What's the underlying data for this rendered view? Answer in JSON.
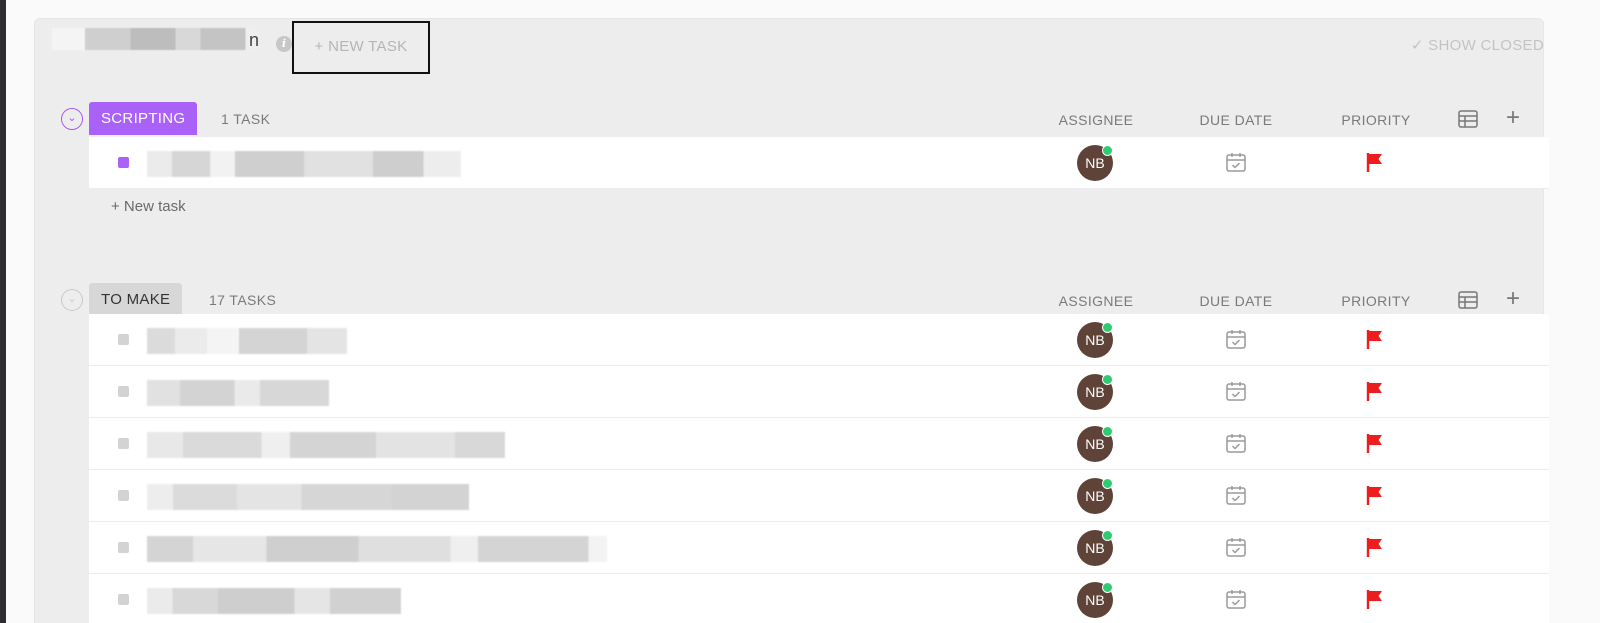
{
  "header": {
    "list_title_suffix": "n",
    "new_task_label": "+ NEW TASK",
    "show_closed_label": "✓ SHOW CLOSED"
  },
  "columns": {
    "assignee": "ASSIGNEE",
    "due_date": "DUE DATE",
    "priority": "PRIORITY"
  },
  "groups": [
    {
      "status": "SCRIPTING",
      "count": "1 TASK",
      "color": "#a961f7",
      "new_task_link": "+ New task",
      "tasks": [
        {
          "assignee": "NB",
          "priority": "urgent",
          "flag_color": "#ee1c1c"
        }
      ]
    },
    {
      "status": "TO MAKE",
      "count": "17 TASKS",
      "color": "#d7d7d7",
      "tasks": [
        {
          "assignee": "NB",
          "priority": "urgent",
          "flag_color": "#ee1c1c"
        },
        {
          "assignee": "NB",
          "priority": "urgent",
          "flag_color": "#ee1c1c"
        },
        {
          "assignee": "NB",
          "priority": "urgent",
          "flag_color": "#ee1c1c"
        },
        {
          "assignee": "NB",
          "priority": "urgent",
          "flag_color": "#ee1c1c"
        },
        {
          "assignee": "NB",
          "priority": "urgent",
          "flag_color": "#ee1c1c"
        },
        {
          "assignee": "NB",
          "priority": "urgent",
          "flag_color": "#ee1c1c"
        }
      ]
    }
  ],
  "icons": {
    "info": "info-icon",
    "collapse": "chevron-down-icon",
    "table": "table-icon",
    "add": "plus-icon",
    "calendar": "calendar-icon",
    "flag": "flag-icon"
  },
  "colors": {
    "accent": "#a961f7",
    "avatar_bg": "#5f4238",
    "online": "#2ecc71",
    "flag": "#ee1c1c"
  }
}
